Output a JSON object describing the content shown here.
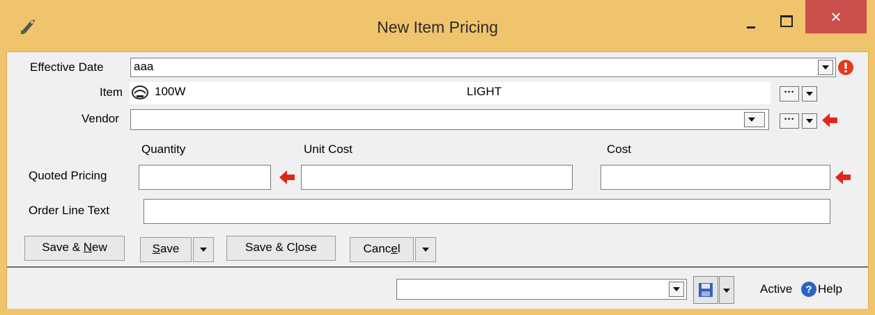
{
  "window": {
    "title": "New Item Pricing",
    "close_glyph": "×"
  },
  "form": {
    "effective_date": {
      "label": "Effective Date",
      "value": "aaa"
    },
    "item": {
      "label": "Item",
      "code": "100W",
      "description": "LIGHT"
    },
    "vendor": {
      "label": "Vendor",
      "value": ""
    },
    "columns": {
      "quantity": "Quantity",
      "unit_cost": "Unit Cost",
      "cost": "Cost"
    },
    "quoted_pricing": {
      "label": "Quoted Pricing",
      "quantity": "",
      "unit_cost": "",
      "cost": ""
    },
    "order_line_text": {
      "label": "Order Line Text",
      "value": ""
    }
  },
  "buttons": {
    "save_new": {
      "pre": "Save & ",
      "underline": "N",
      "post": "ew"
    },
    "save": {
      "pre": "",
      "underline": "S",
      "post": "ave"
    },
    "save_close": {
      "pre": "Save & C",
      "underline": "l",
      "post": "ose"
    },
    "cancel": {
      "pre": "Canc",
      "underline": "e",
      "post": "l"
    }
  },
  "statusbar": {
    "selector_value": "",
    "status_text": "Active",
    "help_label": "Help"
  },
  "icons": {
    "app": "tag-icon",
    "error": "error-icon",
    "item_lookup": "item-picker-icon",
    "required": "required-arrow-icon",
    "save_layout": "floppy-icon",
    "help": "help-icon"
  },
  "colors": {
    "title_bar": "#f0c46c",
    "close_button": "#c9504b",
    "required_arrow": "#e0261a",
    "error_badge": "#e03b1f",
    "help_badge": "#2a64c5"
  }
}
